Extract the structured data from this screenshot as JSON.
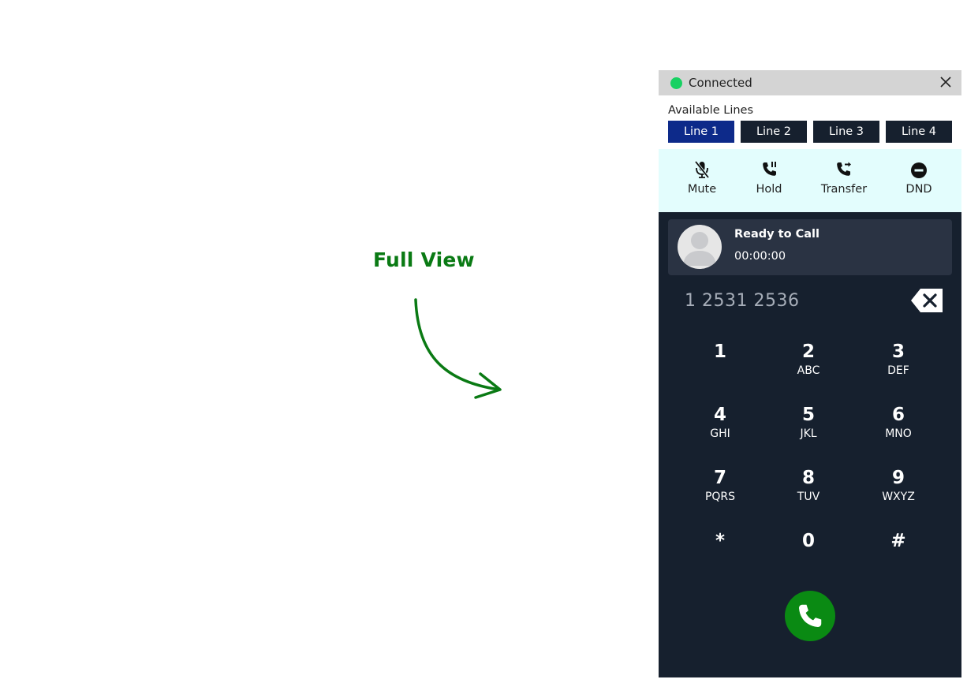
{
  "annotation": {
    "title": "Full View"
  },
  "colors": {
    "connected": "#17d162",
    "active_line": "#0d2a8a",
    "panel_bg": "#16202e",
    "controls_bg": "#e3fdfd",
    "call_button": "#0a8a13",
    "annotation": "#0a7a14"
  },
  "status": {
    "text": "Connected",
    "close_icon": "close-icon"
  },
  "lines": {
    "label": "Available Lines",
    "items": [
      {
        "label": "Line 1",
        "active": true
      },
      {
        "label": "Line 2",
        "active": false
      },
      {
        "label": "Line 3",
        "active": false
      },
      {
        "label": "Line 4",
        "active": false
      }
    ]
  },
  "controls": [
    {
      "label": "Mute",
      "icon": "mic-off-icon"
    },
    {
      "label": "Hold",
      "icon": "phone-hold-icon"
    },
    {
      "label": "Transfer",
      "icon": "phone-forward-icon"
    },
    {
      "label": "DND",
      "icon": "do-not-disturb-icon"
    }
  ],
  "call": {
    "status": "Ready to Call",
    "timer": "00:00:00"
  },
  "dialer": {
    "number": "1 2531 2536",
    "keys": [
      {
        "digit": "1",
        "letters": ""
      },
      {
        "digit": "2",
        "letters": "ABC"
      },
      {
        "digit": "3",
        "letters": "DEF"
      },
      {
        "digit": "4",
        "letters": "GHI"
      },
      {
        "digit": "5",
        "letters": "JKL"
      },
      {
        "digit": "6",
        "letters": "MNO"
      },
      {
        "digit": "7",
        "letters": "PQRS"
      },
      {
        "digit": "8",
        "letters": "TUV"
      },
      {
        "digit": "9",
        "letters": "WXYZ"
      },
      {
        "digit": "*",
        "letters": ""
      },
      {
        "digit": "0",
        "letters": ""
      },
      {
        "digit": "#",
        "letters": ""
      }
    ]
  }
}
